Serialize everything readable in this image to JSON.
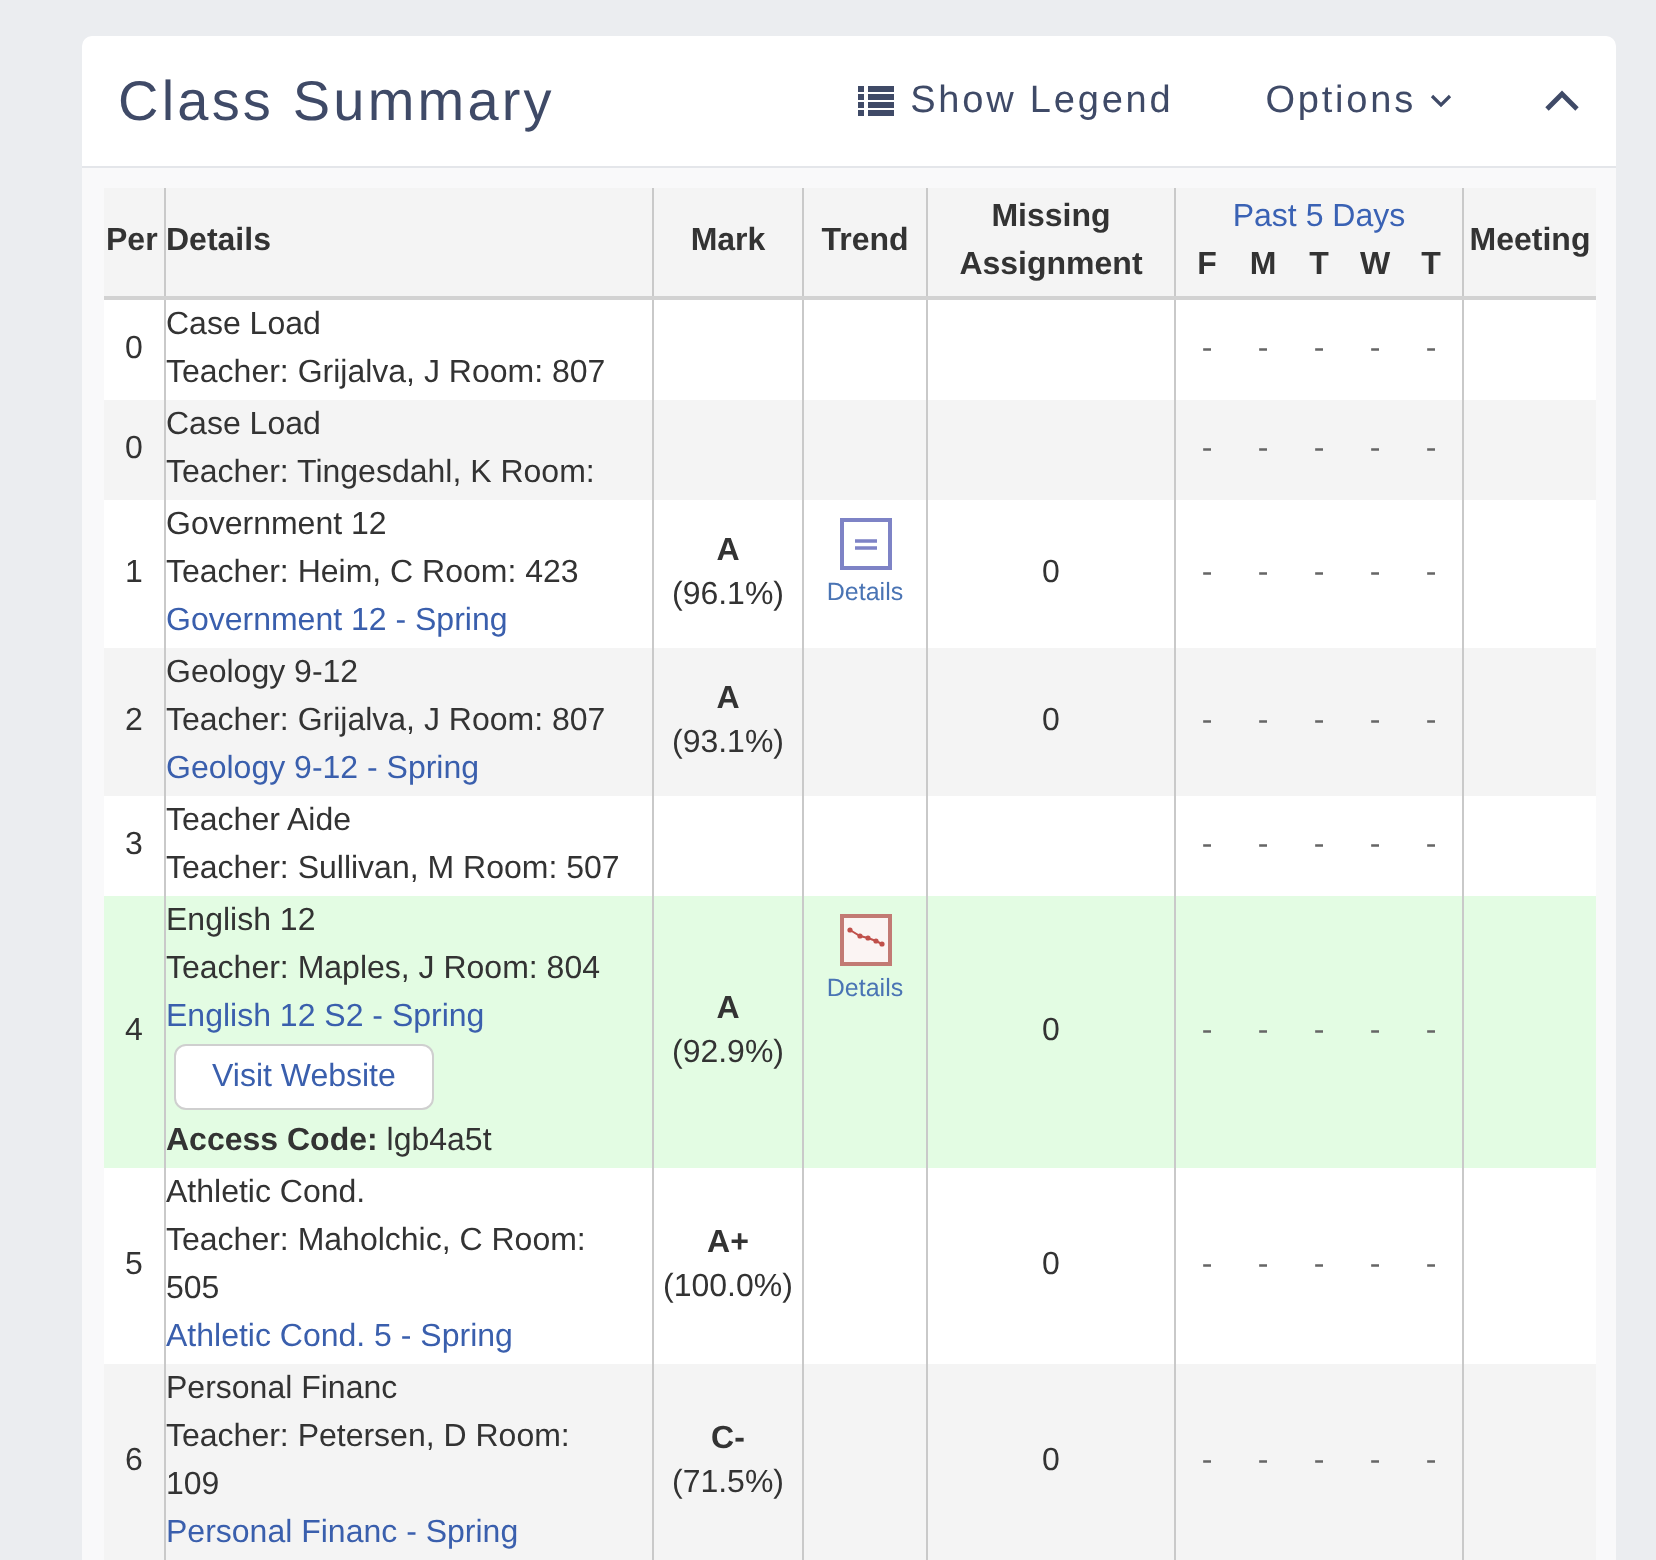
{
  "panel": {
    "title": "Class Summary",
    "legend_button": "Show Legend",
    "options_button": "Options",
    "expanded": true
  },
  "table": {
    "columns": [
      {
        "kind": "period",
        "label": "Per"
      },
      {
        "kind": "details",
        "label": "Details"
      },
      {
        "kind": "mark",
        "label": "Mark"
      },
      {
        "kind": "trend",
        "label": "Trend"
      },
      {
        "kind": "missing",
        "label": "Missing Assignment"
      },
      {
        "kind": "days",
        "label": "Past 5 Days",
        "days": [
          "F",
          "M",
          "T",
          "W",
          "T"
        ]
      },
      {
        "kind": "meeting",
        "label": "Meeting"
      }
    ],
    "rows": [
      {
        "period": "0",
        "course": "Case Load",
        "teacher": "Teacher: Grijalva, J Room: 807",
        "highlighted": false,
        "past_5_days": [
          "-",
          "-",
          "-",
          "-",
          "-"
        ]
      },
      {
        "period": "0",
        "course": "Case Load",
        "teacher": "Teacher: Tingesdahl, K Room:",
        "highlighted": false,
        "past_5_days": [
          "-",
          "-",
          "-",
          "-",
          "-"
        ]
      },
      {
        "period": "1",
        "course": "Government 12",
        "teacher": "Teacher: Heim, C Room: 423",
        "link": "Government 12 - Spring",
        "highlighted": false,
        "mark": {
          "grade": "A",
          "percent": "(96.1%)"
        },
        "trend": {
          "kind": "summary",
          "label": "Details"
        },
        "missing": "0",
        "past_5_days": [
          "-",
          "-",
          "-",
          "-",
          "-"
        ]
      },
      {
        "period": "2",
        "course": "Geology 9-12",
        "teacher": "Teacher: Grijalva, J Room: 807",
        "link": "Geology 9-12 - Spring",
        "highlighted": false,
        "mark": {
          "grade": "A",
          "percent": "(93.1%)"
        },
        "missing": "0",
        "past_5_days": [
          "-",
          "-",
          "-",
          "-",
          "-"
        ]
      },
      {
        "period": "3",
        "course": "Teacher Aide",
        "teacher": "Teacher: Sullivan, M Room: 507",
        "highlighted": false,
        "past_5_days": [
          "-",
          "-",
          "-",
          "-",
          "-"
        ]
      },
      {
        "period": "4",
        "course": "English 12",
        "teacher": "Teacher: Maples, J Room: 804",
        "link": "English 12 S2 - Spring",
        "website_button": "Visit Website",
        "access_code": "**Access Code:** lgb4a5t",
        "highlighted": true,
        "mark": {
          "grade": "A",
          "percent": "(92.9%)"
        },
        "trend": {
          "kind": "graph",
          "label": "Details"
        },
        "missing": "0",
        "past_5_days": [
          "-",
          "-",
          "-",
          "-",
          "-"
        ]
      },
      {
        "period": "5",
        "course": "Athletic Cond.",
        "teacher": "Teacher: Maholchic, C Room: 505",
        "link": "Athletic Cond. 5 - Spring",
        "highlighted": false,
        "mark": {
          "grade": "A+",
          "percent": "(100.0%)"
        },
        "missing": "0",
        "past_5_days": [
          "-",
          "-",
          "-",
          "-",
          "-"
        ]
      },
      {
        "period": "6",
        "course": "Personal Financ",
        "teacher": "Teacher: Petersen, D Room: 109",
        "link": "Personal Financ - Spring",
        "highlighted": false,
        "mark": {
          "grade": "C-",
          "percent": "(71.5%)"
        },
        "missing": "0",
        "past_5_days": [
          "-",
          "-",
          "-",
          "-",
          "-"
        ]
      }
    ]
  }
}
